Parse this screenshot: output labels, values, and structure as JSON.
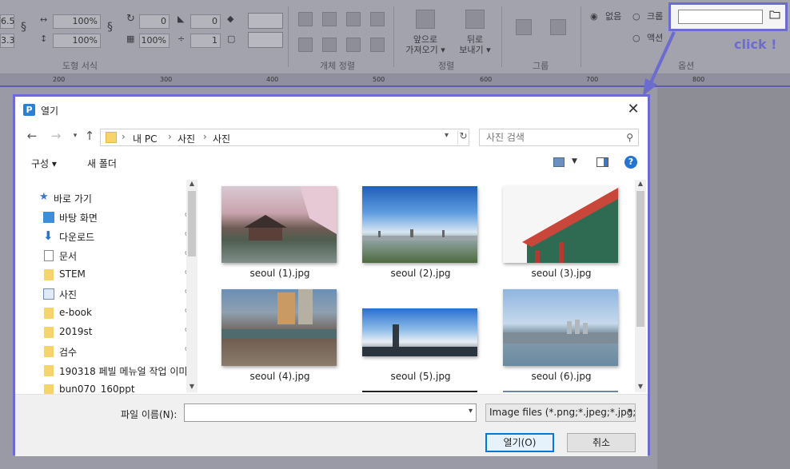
{
  "ribbon": {
    "values": {
      "v1": "6.5",
      "v2": "3.3",
      "width_pct": "100%",
      "height_pct": "100%",
      "rotate": "0",
      "skew": "0",
      "pattern_pct": "100%",
      "line": "1"
    },
    "groups": {
      "shape_format": "도형 서식",
      "object_align": "개체 정렬",
      "arrange": "정렬",
      "group": "그룹",
      "options": "옵션"
    },
    "arrange_buttons": {
      "bring_forward": "앞으로\n가져오기 ▾",
      "send_backward": "뒤로\n보내기 ▾"
    },
    "radio": {
      "none": "없음",
      "crop": "크롭",
      "action": "액션"
    },
    "ruler_ticks": [
      "200",
      "300",
      "400",
      "500",
      "600",
      "700",
      "800"
    ]
  },
  "callout": {
    "text": "click !",
    "color": "#6b6bd0"
  },
  "dialog": {
    "title": "열기",
    "address": {
      "crumbs": [
        "내 PC",
        "사진",
        "사진"
      ]
    },
    "search_placeholder": "사진 검색",
    "toolbar": {
      "organize": "구성 ▾",
      "new_folder": "새 폴더"
    },
    "nav_items": [
      {
        "label": "바로 가기",
        "icon": "star-icon",
        "pinned": false
      },
      {
        "label": "바탕 화면",
        "icon": "desktop-icon",
        "pinned": true
      },
      {
        "label": "다운로드",
        "icon": "download-icon",
        "pinned": true
      },
      {
        "label": "문서",
        "icon": "document-icon",
        "pinned": true
      },
      {
        "label": "STEM",
        "icon": "folder-icon",
        "pinned": true
      },
      {
        "label": "사진",
        "icon": "pictures-icon",
        "pinned": true
      },
      {
        "label": "e-book",
        "icon": "folder-icon",
        "pinned": true
      },
      {
        "label": "2019st",
        "icon": "folder-icon",
        "pinned": true
      },
      {
        "label": "검수",
        "icon": "folder-icon",
        "pinned": true
      },
      {
        "label": "190318 페빌 메뉴얼 작업 이미",
        "icon": "folder-icon",
        "pinned": false
      },
      {
        "label": "bun070_160ppt",
        "icon": "folder-icon",
        "pinned": false
      }
    ],
    "files": [
      {
        "name": "seoul (1).jpg"
      },
      {
        "name": "seoul (2).jpg"
      },
      {
        "name": "seoul (3).jpg"
      },
      {
        "name": "seoul (4).jpg"
      },
      {
        "name": "seoul (5).jpg"
      },
      {
        "name": "seoul (6).jpg"
      }
    ],
    "filename_label": "파일 이름(N):",
    "filename_value": "",
    "filetype": "Image files (*.png;*.jpeg;*.jpg;",
    "open_button": "열기(O)",
    "cancel_button": "취소"
  }
}
